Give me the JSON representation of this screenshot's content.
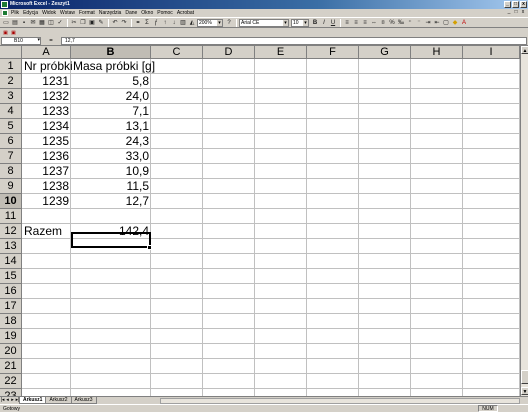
{
  "window": {
    "title": "Microsoft Excel - Zeszyt1",
    "controls": [
      "_",
      "□",
      "x"
    ]
  },
  "menu": {
    "items": [
      "Plik",
      "Edycja",
      "Widok",
      "Wstaw",
      "Format",
      "Narzędzia",
      "Dane",
      "Okno",
      "Pomoc",
      "Acrobat"
    ],
    "doc_controls": [
      "_",
      "□",
      "x"
    ]
  },
  "toolbar": {
    "zoom": "200%",
    "font": "Arial CE",
    "size": "10",
    "bold": "B",
    "italic": "I",
    "underline": "U"
  },
  "formula_bar": {
    "name_box": "B10",
    "eq": "=",
    "content": "12,7"
  },
  "columns": [
    "A",
    "B",
    "C",
    "D",
    "E",
    "F",
    "G",
    "H",
    "I"
  ],
  "rows": [
    "1",
    "2",
    "3",
    "4",
    "5",
    "6",
    "7",
    "8",
    "9",
    "10",
    "11",
    "12",
    "13",
    "14",
    "15",
    "16",
    "17",
    "18",
    "19",
    "20",
    "21",
    "22",
    "23",
    "24"
  ],
  "active_cell": {
    "col": "B",
    "row": "10"
  },
  "sheet": {
    "header": {
      "a": "Nr próbki",
      "b": "Masa próbki [g]"
    },
    "data": [
      {
        "a": "1231",
        "b": "5,8"
      },
      {
        "a": "1232",
        "b": "24,0"
      },
      {
        "a": "1233",
        "b": "7,1"
      },
      {
        "a": "1234",
        "b": "13,1"
      },
      {
        "a": "1235",
        "b": "24,3"
      },
      {
        "a": "1236",
        "b": "33,0"
      },
      {
        "a": "1237",
        "b": "10,9"
      },
      {
        "a": "1238",
        "b": "11,5"
      },
      {
        "a": "1239",
        "b": "12,7"
      }
    ],
    "total": {
      "a": "Razem",
      "b": "142,4"
    }
  },
  "tabs": {
    "nav": [
      "|◂",
      "◂",
      "▸",
      "▸|"
    ],
    "sheets": [
      "Arkusz1",
      "Arkusz2",
      "Arkusz3"
    ],
    "active": "Arkusz1"
  },
  "status": {
    "text": "Gotowy",
    "num": "NUM"
  }
}
